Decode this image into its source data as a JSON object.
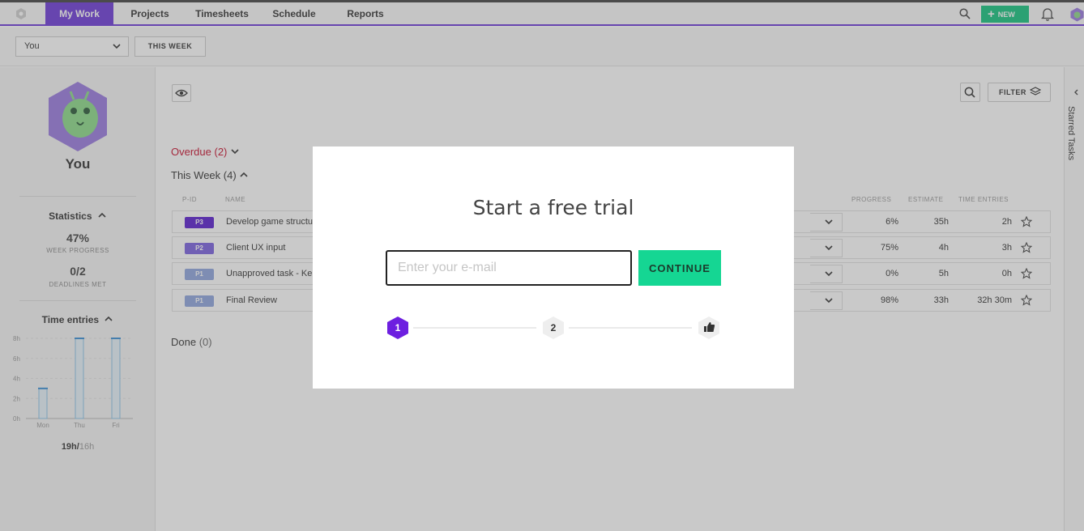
{
  "nav": {
    "tabs": [
      "My Work",
      "Projects",
      "Timesheets",
      "Schedule",
      "Reports"
    ],
    "new_label": "NEW"
  },
  "toolbar": {
    "person_select": "You",
    "week_button": "THIS WEEK"
  },
  "profile": {
    "name": "You",
    "statistics_heading": "Statistics",
    "week_progress_value": "47%",
    "week_progress_label": "WEEK PROGRESS",
    "deadlines_value": "0/2",
    "deadlines_label": "DEADLINES MET",
    "time_entries_heading": "Time entries",
    "time_entries_total": "19h/",
    "time_entries_capacity": "16h"
  },
  "time_chart": {
    "y_ticks": [
      "8h",
      "6h",
      "4h",
      "2h",
      "0h"
    ],
    "x_labels": [
      "Mon",
      "Thu",
      "Fri"
    ],
    "values_hours": [
      3,
      8,
      8
    ]
  },
  "main": {
    "filter_label": "FILTER",
    "overdue_label": "Overdue",
    "overdue_count": "(2)",
    "this_week_label": "This Week",
    "this_week_count": "(4)",
    "done_label": "Done",
    "done_count": "(0)",
    "columns": {
      "pid": "P-ID",
      "name": "NAME",
      "progress": "PROGRESS",
      "estimate": "ESTIMATE",
      "time_entries": "TIME ENTRIES"
    },
    "tasks": [
      {
        "pid": "P3",
        "pid_color": "#5a1fd0",
        "name": "Develop game structu",
        "progress": "6%",
        "estimate": "35h",
        "time": "2h"
      },
      {
        "pid": "P2",
        "pid_color": "#7b62e0",
        "name": "Client UX input",
        "progress": "75%",
        "estimate": "4h",
        "time": "3h"
      },
      {
        "pid": "P1",
        "pid_color": "#8fa6de",
        "name": "Unapproved task - Ke",
        "progress": "0%",
        "estimate": "5h",
        "time": "0h"
      },
      {
        "pid": "P1",
        "pid_color": "#8fa6de",
        "name": "Final Review",
        "progress": "98%",
        "estimate": "33h",
        "time": "32h 30m"
      }
    ]
  },
  "rail": {
    "label": "Starred Tasks"
  },
  "modal": {
    "title": "Start a free trial",
    "email_placeholder": "Enter your e-mail",
    "continue_label": "CONTINUE",
    "steps": [
      "1",
      "2"
    ]
  },
  "colors": {
    "brand": "#6d3bd8",
    "new_button": "#15c47f",
    "continue": "#15d693",
    "overdue": "#c8102e"
  }
}
